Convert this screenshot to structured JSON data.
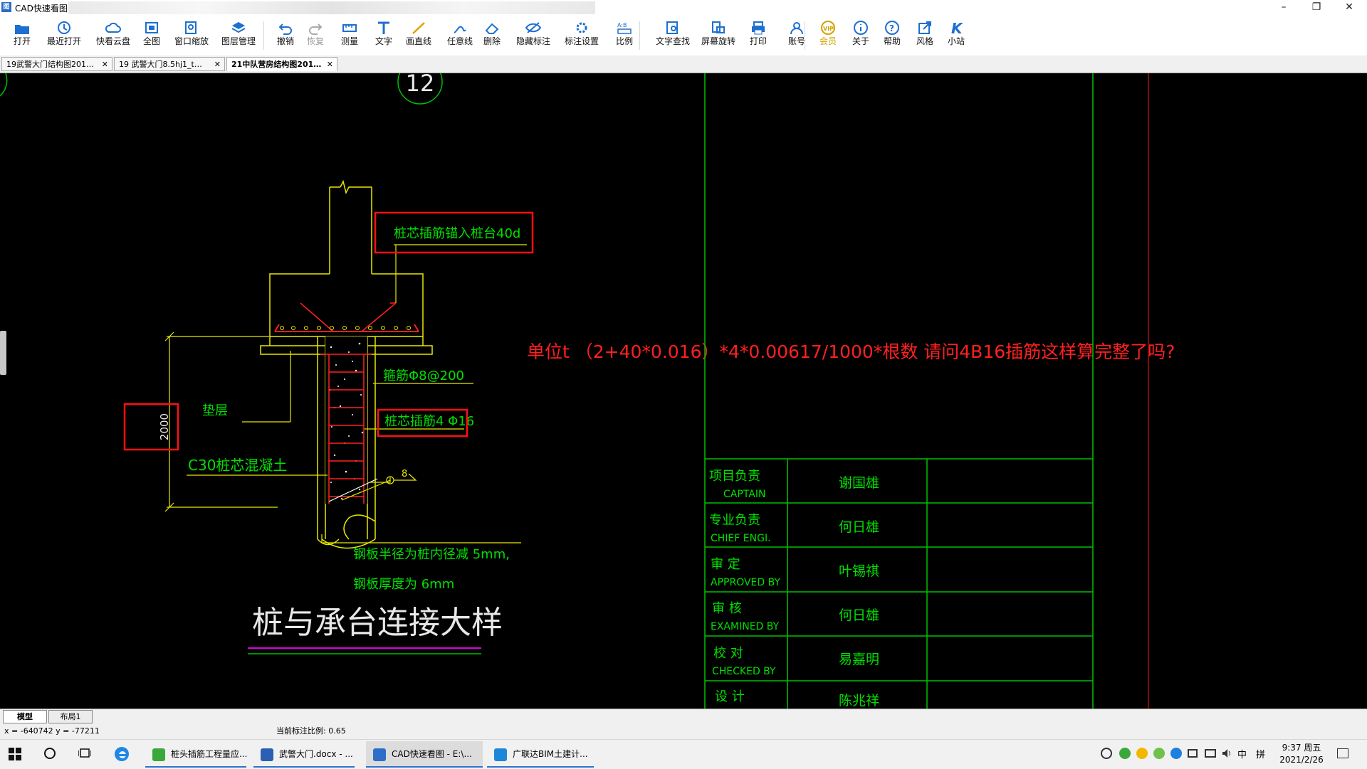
{
  "window": {
    "title": "CAD快速看图",
    "minimize": "–",
    "maximize": "❐",
    "close": "✕"
  },
  "toolbar": [
    {
      "label": "打开",
      "icon": "folder-open-icon"
    },
    {
      "label": "最近打开",
      "icon": "history-icon"
    },
    {
      "label": "快看云盘",
      "icon": "cloud-icon"
    },
    {
      "label": "全图",
      "icon": "fit-all-icon"
    },
    {
      "label": "窗口缩放",
      "icon": "zoom-window-icon"
    },
    {
      "label": "图层管理",
      "icon": "layers-icon"
    },
    {
      "label": "撤销",
      "icon": "undo-icon"
    },
    {
      "label": "恢复",
      "icon": "redo-icon",
      "disabled": true
    },
    {
      "label": "测量",
      "icon": "measure-icon"
    },
    {
      "label": "文字",
      "icon": "text-icon"
    },
    {
      "label": "画直线",
      "icon": "line-icon"
    },
    {
      "label": "任意线",
      "icon": "freehand-icon"
    },
    {
      "label": "删除",
      "icon": "eraser-icon"
    },
    {
      "label": "隐藏标注",
      "icon": "hide-annotation-icon"
    },
    {
      "label": "标注设置",
      "icon": "annotation-settings-icon"
    },
    {
      "label": "比例",
      "icon": "scale-icon"
    },
    {
      "label": "文字查找",
      "icon": "text-search-icon"
    },
    {
      "label": "屏幕旋转",
      "icon": "rotate-screen-icon"
    },
    {
      "label": "打印",
      "icon": "printer-icon"
    },
    {
      "label": "账号",
      "icon": "account-icon"
    },
    {
      "label": "会员",
      "icon": "vip-icon"
    },
    {
      "label": "关于",
      "icon": "info-icon"
    },
    {
      "label": "帮助",
      "icon": "help-icon"
    },
    {
      "label": "风格",
      "icon": "style-icon"
    },
    {
      "label": "小站",
      "icon": "k-site-icon"
    }
  ],
  "tabs": [
    {
      "label": "19武警大门结构图201…",
      "close": "✕",
      "active": false
    },
    {
      "label": "19 武警大门8.5hj1_t…",
      "close": "✕",
      "active": false
    },
    {
      "label": "21中队营房结构图201…",
      "close": "✕",
      "active": true
    }
  ],
  "drawing": {
    "grid_bubble": "12",
    "anchor_note": "桩芯插筋锚入桩台40d",
    "stirrup_note": "箍筋Φ8@200",
    "rebar_note": "桩芯插筋4 Φ16",
    "cushion_label": "垫层",
    "dimension": "2000",
    "concrete_label": "C30桩芯混凝土",
    "weld_mark": "8",
    "plate_note_1": "钢板半径为桩内径减 5mm,",
    "plate_note_2": "钢板厚度为 6mm",
    "detail_title": "桩与承台连接大样",
    "question": "单位t （2+40*0.016）*4*0.00617/1000*根数     请问4B16插筋这样算完整了吗?"
  },
  "title_block": [
    {
      "cn": "项目负责",
      "en": "CAPTAIN",
      "name": "谢国雄"
    },
    {
      "cn": "专业负责",
      "en": "CHIEF  ENGI.",
      "name": "何日雄"
    },
    {
      "cn": "审    定",
      "en": "APPROVED BY",
      "name": "叶锡祺"
    },
    {
      "cn": "审    核",
      "en": "EXAMINED BY",
      "name": "何日雄"
    },
    {
      "cn": "校    对",
      "en": "CHECKED BY",
      "name": "易嘉明"
    },
    {
      "cn": "设    计",
      "en": "",
      "name": "陈兆祥"
    }
  ],
  "layout_tabs": [
    {
      "label": "模型"
    },
    {
      "label": "布局1"
    }
  ],
  "status": {
    "coords": "x = -640742  y = -77211",
    "scale": "当前标注比例: 0.65"
  },
  "taskbar": {
    "apps": [
      {
        "label": "桩头插筋工程量应...",
        "icon_color": "#3aa83a"
      },
      {
        "label": "武警大门.docx - ...",
        "icon_color": "#2b5fb4"
      },
      {
        "label": "CAD快速看图 - E:\\...",
        "icon_color": "#2e6ec8"
      },
      {
        "label": "广联达BIM土建计...",
        "icon_color": "#1d86d8"
      }
    ],
    "ime": "中",
    "ime2": "拼",
    "time": "9:37 周五",
    "date": "2021/2/26"
  }
}
